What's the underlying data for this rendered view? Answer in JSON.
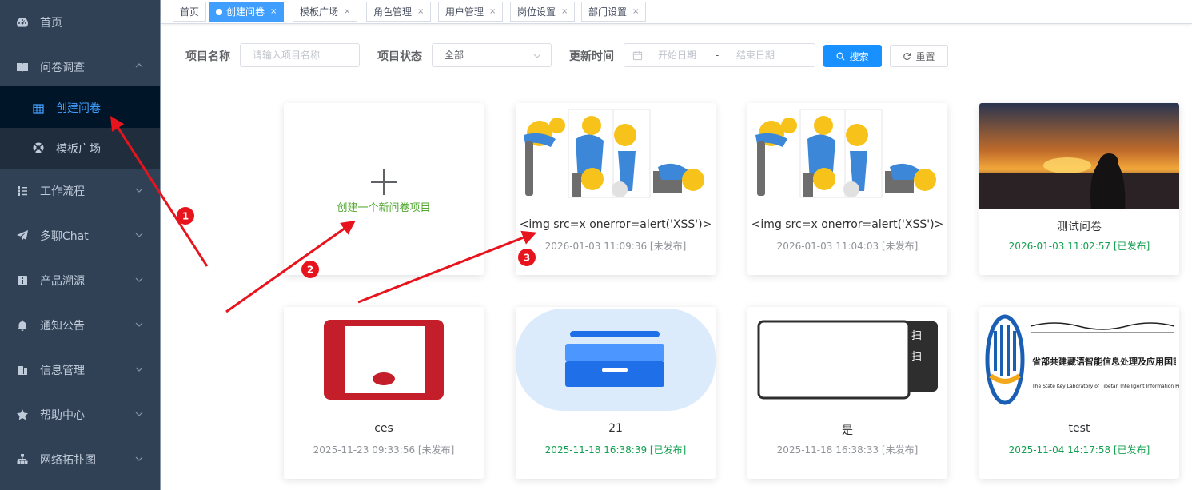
{
  "sidebar": {
    "items": [
      {
        "label": "首页",
        "icon": "dashboard-icon"
      },
      {
        "label": "问卷调查",
        "icon": "book-icon"
      },
      {
        "label": "创建问卷",
        "icon": "table-icon"
      },
      {
        "label": "模板广场",
        "icon": "lifebuoy-icon"
      },
      {
        "label": "工作流程",
        "icon": "list-tree-icon"
      },
      {
        "label": "多聊Chat",
        "icon": "paper-plane-icon"
      },
      {
        "label": "产品溯源",
        "icon": "info-box-icon"
      },
      {
        "label": "通知公告",
        "icon": "bell-icon"
      },
      {
        "label": "信息管理",
        "icon": "documents-icon"
      },
      {
        "label": "帮助中心",
        "icon": "star-icon"
      },
      {
        "label": "网络拓扑图",
        "icon": "sitemap-icon"
      }
    ]
  },
  "tags": [
    {
      "label": "首页"
    },
    {
      "label": "创建问卷"
    },
    {
      "label": "模板广场"
    },
    {
      "label": "角色管理"
    },
    {
      "label": "用户管理"
    },
    {
      "label": "岗位设置"
    },
    {
      "label": "部门设置"
    }
  ],
  "tag_close": "×",
  "search": {
    "name_label": "项目名称",
    "name_placeholder": "请输入项目名称",
    "status_label": "项目状态",
    "status_value": "全部",
    "time_label": "更新时间",
    "start_placeholder": "开始日期",
    "range_sep": "-",
    "end_placeholder": "结束日期",
    "search_btn": "搜索",
    "reset_btn": "重置"
  },
  "create_card": {
    "label": "创建一个新问卷项目"
  },
  "cards": [
    {
      "title": "<img src=x onerror=alert('XSS')>",
      "meta": "2026-01-03 11:09:36 [未发布]",
      "published": false
    },
    {
      "title": "<img src=x onerror=alert('XSS')>",
      "meta": "2026-01-03 11:04:03 [未发布]",
      "published": false
    },
    {
      "title": "测试问卷",
      "meta": "2026-01-03 11:02:57 [已发布]",
      "published": true
    },
    {
      "title": "ces",
      "meta": "2025-11-23 09:33:56 [未发布]",
      "published": false
    },
    {
      "title": "21",
      "meta": "2025-11-18 16:38:39 [已发布]",
      "published": true
    },
    {
      "title": "是",
      "meta": "2025-11-18 16:38:33 [未发布]",
      "published": false
    },
    {
      "title": "test",
      "meta": "2025-11-04 14:17:58 [已发布]",
      "published": true
    }
  ],
  "scan_label_1": "扫",
  "scan_label_2": "扫",
  "logo_text": "省部共建藏语智能信息处理及应用国家重点实验室",
  "logo_subtext": "The State Key Laboratory of Tibetan Intelligent Information Processing and Application",
  "annotations": [
    "1",
    "2",
    "3"
  ],
  "colors": {
    "sidebar_bg": "#304156",
    "sidebar_sub_bg": "#1f2d3d",
    "active_blue": "#409eff",
    "primary_btn": "#1890ff",
    "published_green": "#13a050",
    "arrow_red": "#e8141d"
  }
}
